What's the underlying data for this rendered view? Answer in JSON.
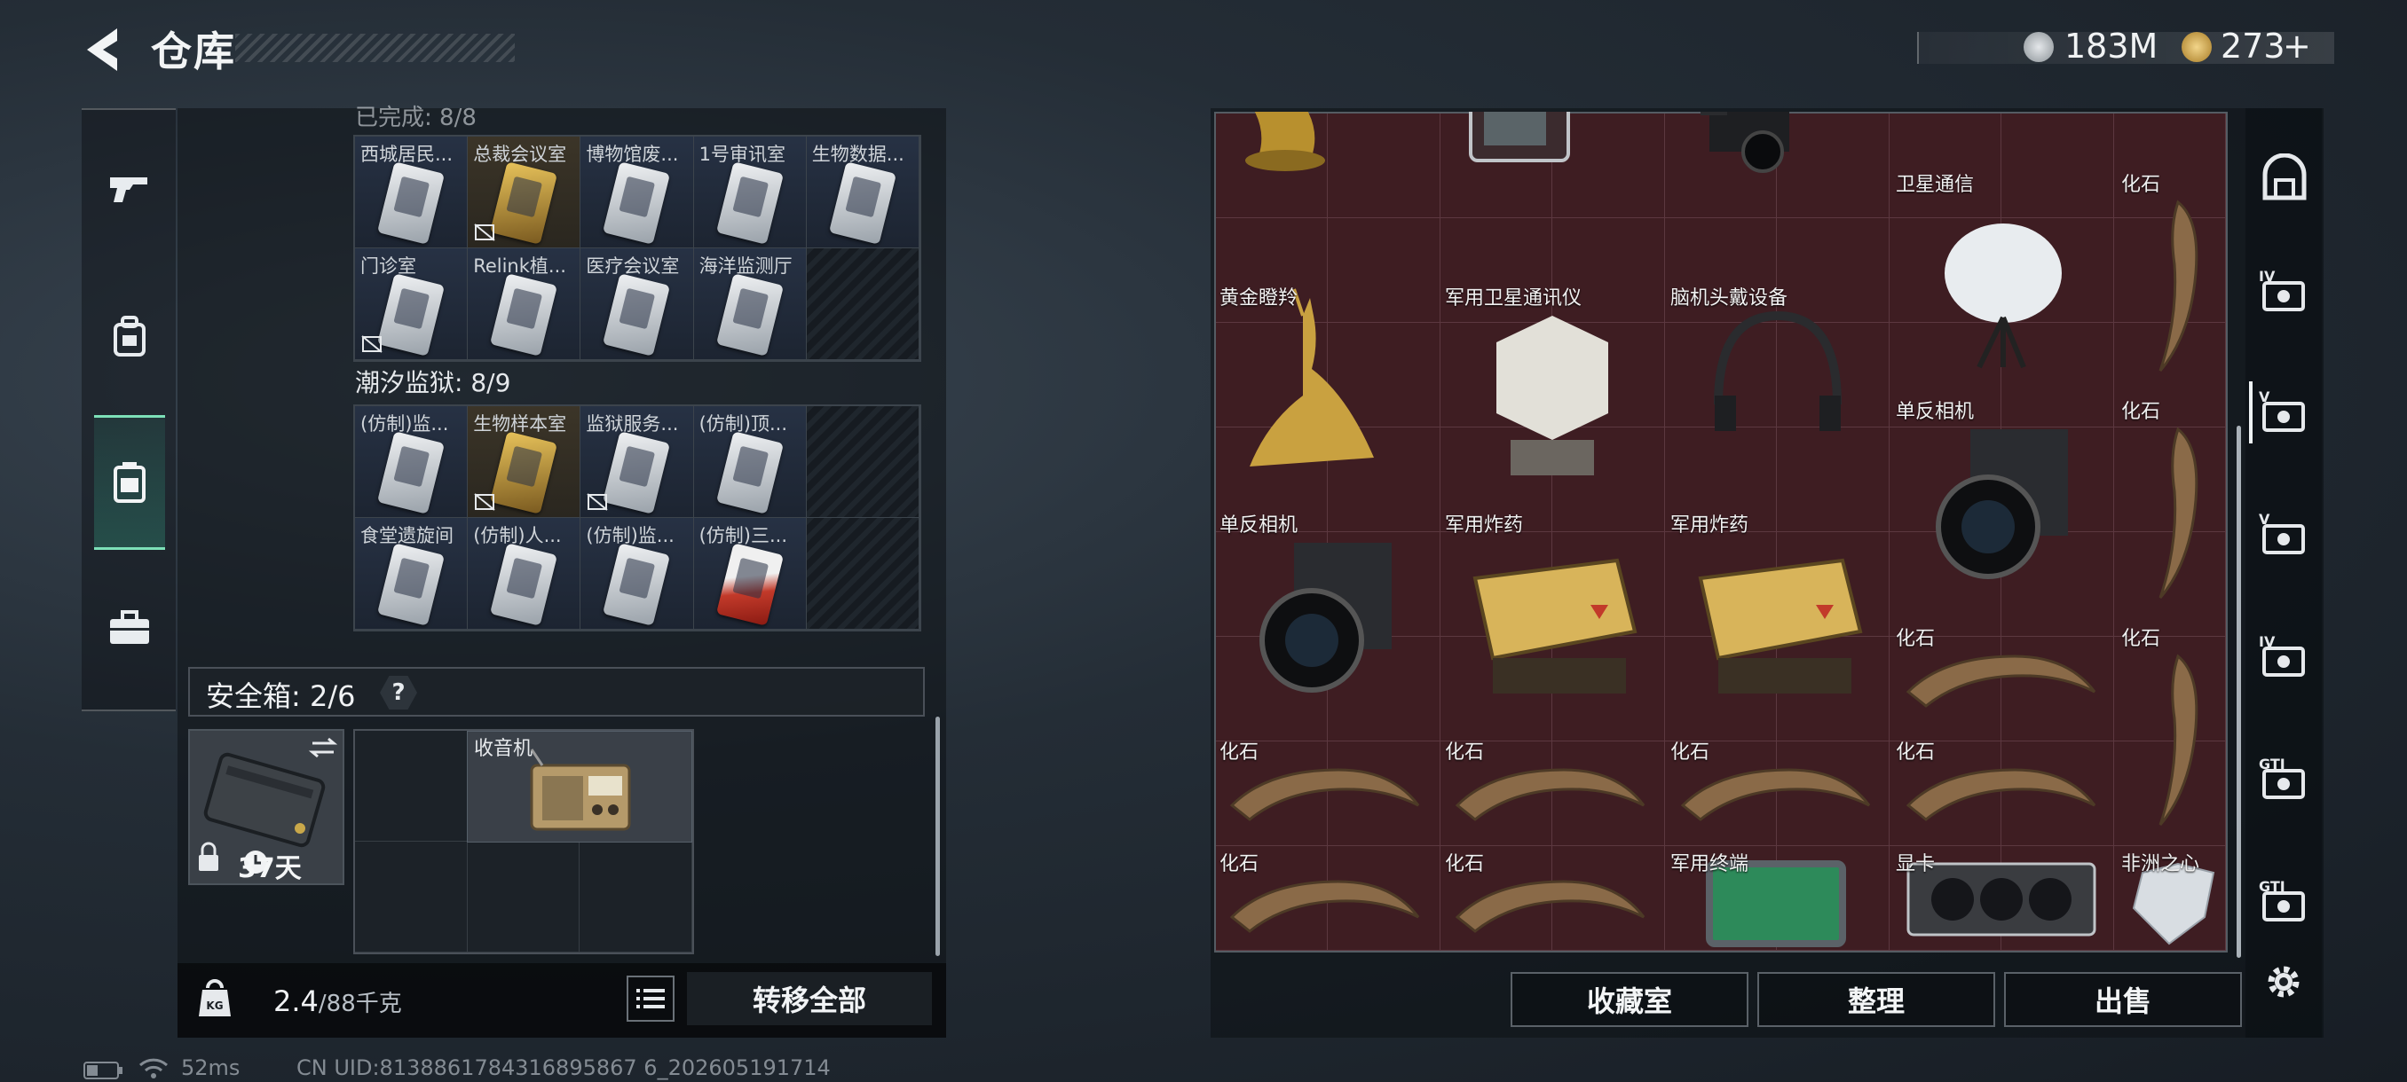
{
  "header": {
    "title": "仓库",
    "currency_silver": "183M",
    "currency_gold": "273",
    "plus_label": "+"
  },
  "side_nav": {
    "items": [
      {
        "icon": "gun-icon"
      },
      {
        "icon": "backpack-icon"
      },
      {
        "icon": "storage-bag-icon",
        "active": true
      },
      {
        "icon": "toolbox-icon"
      }
    ]
  },
  "key_section_top": {
    "subtitle_partial": "已完成: 8/8",
    "rows": [
      [
        {
          "label": "西城居民...",
          "card": "white"
        },
        {
          "label": "总裁会议室",
          "card": "gold",
          "no_icon": true
        },
        {
          "label": "博物馆废...",
          "card": "white"
        },
        {
          "label": "1号审讯室",
          "card": "white"
        },
        {
          "label": "生物数据...",
          "card": "white"
        }
      ],
      [
        {
          "label": "门诊室",
          "card": "white",
          "no_icon": true
        },
        {
          "label": "Relink植...",
          "card": "white"
        },
        {
          "label": "医疗会议室",
          "card": "white"
        },
        {
          "label": "海洋监测厅",
          "card": "white"
        },
        {
          "label": "",
          "empty": true
        }
      ]
    ]
  },
  "key_section_prison": {
    "title": "潮汐监狱: 8/9",
    "rows": [
      [
        {
          "label": "(仿制)监...",
          "card": "white"
        },
        {
          "label": "生物样本室",
          "card": "gold",
          "no_icon": true
        },
        {
          "label": "监狱服务...",
          "card": "white",
          "no_icon": true
        },
        {
          "label": "(仿制)顶...",
          "card": "white"
        },
        {
          "label": "",
          "empty": true
        }
      ],
      [
        {
          "label": "食堂遗旋间",
          "card": "white"
        },
        {
          "label": "(仿制)人...",
          "card": "white"
        },
        {
          "label": "(仿制)监...",
          "card": "white"
        },
        {
          "label": "(仿制)三...",
          "card": "red"
        },
        {
          "label": "",
          "empty": true
        }
      ]
    ]
  },
  "safe_box": {
    "label": "安全箱: 2/6",
    "help": "?",
    "case_days": "37天",
    "radio_label": "收音机"
  },
  "weight": {
    "current": "2.4",
    "max": "/88千克"
  },
  "transfer_all_label": "转移全部",
  "inventory": {
    "items": [
      {
        "name": "",
        "type": "gold-horse"
      },
      {
        "name": "",
        "type": "radio-device"
      },
      {
        "name": "",
        "type": "video-camera"
      },
      {
        "name": "",
        "type": "water-jug"
      },
      {
        "name": "卫星通信",
        "type": "satellite-dish"
      },
      {
        "name": "化石",
        "type": "claw-vertical"
      },
      {
        "name": "黄金瞪羚",
        "type": "gold-gazelle"
      },
      {
        "name": "军用卫星通讯仪",
        "type": "sat-communicator"
      },
      {
        "name": "脑机头戴设备",
        "type": "headset"
      },
      {
        "name": "单反相机",
        "type": "camera"
      },
      {
        "name": "化石",
        "type": "claw-vertical"
      },
      {
        "name": "单反相机",
        "type": "camera"
      },
      {
        "name": "军用炸药",
        "type": "explosive"
      },
      {
        "name": "军用炸药",
        "type": "explosive"
      },
      {
        "name": "化石",
        "type": "claw-horizontal"
      },
      {
        "name": "化石",
        "type": "claw-vertical"
      },
      {
        "name": "化石",
        "type": "claw-horizontal"
      },
      {
        "name": "化石",
        "type": "claw-horizontal"
      },
      {
        "name": "化石",
        "type": "claw-horizontal"
      },
      {
        "name": "化石",
        "type": "claw-horizontal"
      },
      {
        "name": "化石",
        "type": "claw-horizontal"
      },
      {
        "name": "化石",
        "type": "claw-horizontal"
      },
      {
        "name": "军用终端",
        "type": "terminal"
      },
      {
        "name": "显卡",
        "type": "graphics-card"
      },
      {
        "name": "非洲之心",
        "type": "diamond"
      }
    ]
  },
  "actions": {
    "collection": "收藏室",
    "organize": "整理",
    "sell": "出售"
  },
  "filter_rail": {
    "labels": [
      "IV",
      "V",
      "V",
      "IV",
      "GTI",
      "GTI"
    ]
  },
  "status_bar": {
    "ping": "52ms",
    "uid": "CN UID:8138861784316895867 6_202605191714"
  },
  "colors": {
    "inventory_bg": "#3e1d22",
    "active_accent": "#7de0b8"
  }
}
